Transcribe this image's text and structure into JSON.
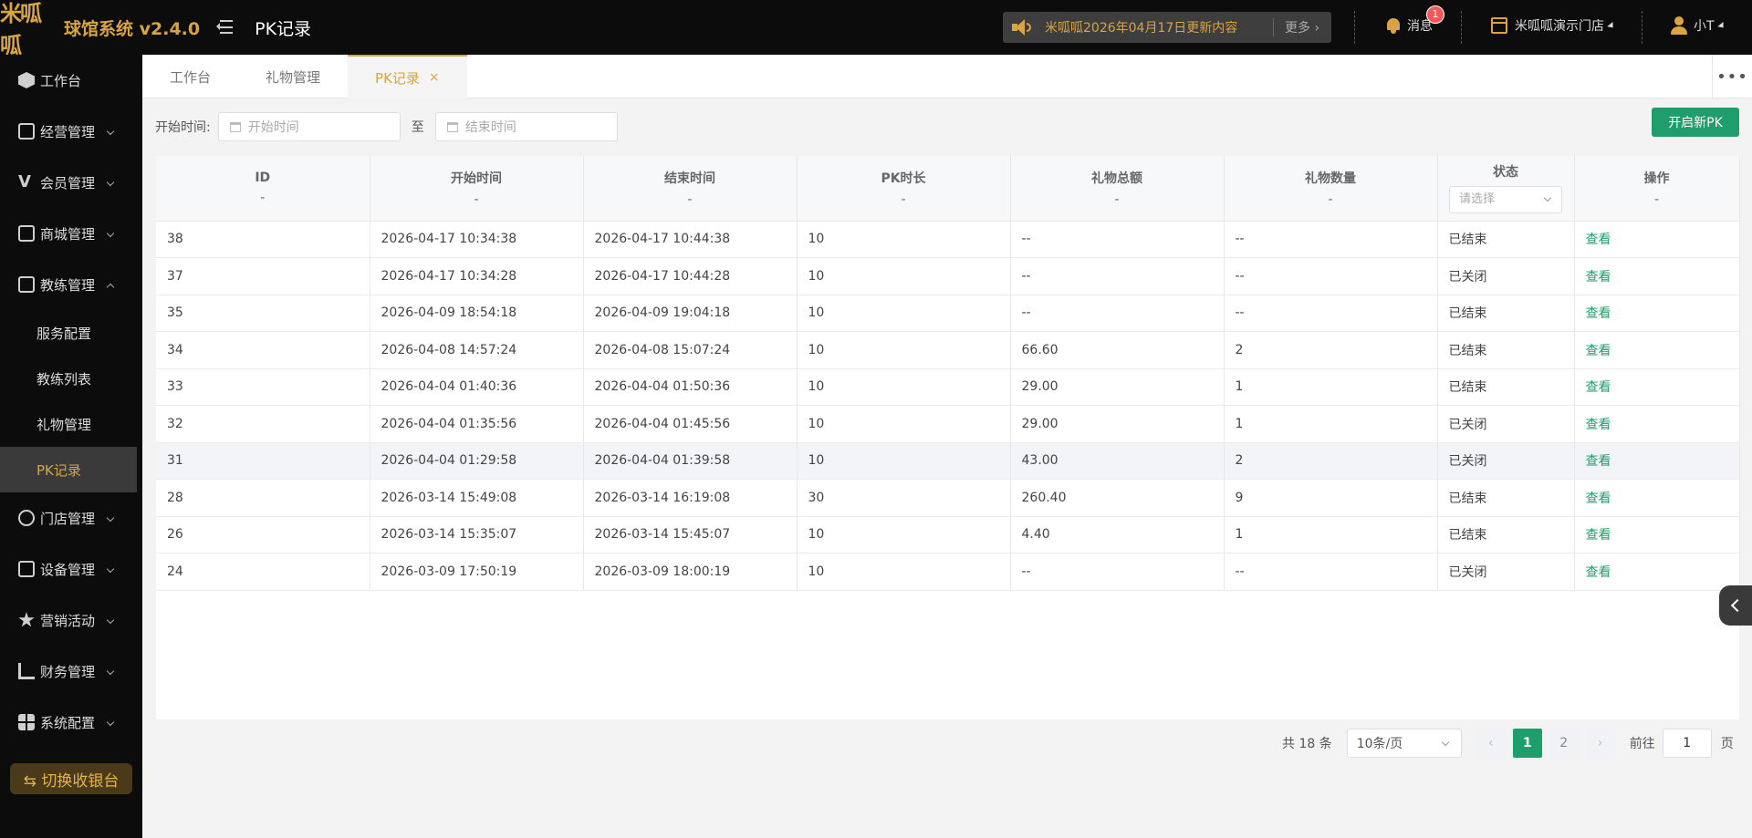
{
  "header": {
    "logo_text": "米呱呱",
    "app_name": "球馆系统 v2.4.0",
    "page_title": "PK记录",
    "notice_text": "米呱呱2026年04月17日更新内容",
    "notice_more": "更多",
    "messages_label": "消息",
    "messages_badge": "1",
    "store_name": "米呱呱演示门店",
    "user_name": "小T"
  },
  "sidebar": {
    "items": [
      {
        "label": "工作台",
        "icon": "cube-icon"
      },
      {
        "label": "经营管理",
        "icon": "shop-icon"
      },
      {
        "label": "会员管理",
        "icon": "vip-icon"
      },
      {
        "label": "商城管理",
        "icon": "bag-icon"
      },
      {
        "label": "教练管理",
        "icon": "coach-icon"
      }
    ],
    "coach_sub": [
      "服务配置",
      "教练列表",
      "礼物管理",
      "PK记录"
    ],
    "items_after": [
      {
        "label": "门店管理",
        "icon": "coins-icon"
      },
      {
        "label": "设备管理",
        "icon": "device-icon"
      },
      {
        "label": "营销活动",
        "icon": "star-icon"
      },
      {
        "label": "财务管理",
        "icon": "finance-icon"
      },
      {
        "label": "系统配置",
        "icon": "grid-icon"
      }
    ],
    "switch_button": "⇆ 切换收银台"
  },
  "tabs": [
    {
      "label": "工作台"
    },
    {
      "label": "礼物管理"
    },
    {
      "label": "PK记录",
      "close": "×"
    }
  ],
  "filters": {
    "start_label": "开始时间:",
    "start_placeholder": "开始时间",
    "to_label": "至",
    "end_placeholder": "结束时间",
    "new_pk_button": "开启新PK"
  },
  "table": {
    "columns": [
      {
        "title": "ID",
        "sub": "-"
      },
      {
        "title": "开始时间",
        "sub": "-"
      },
      {
        "title": "结束时间",
        "sub": "-"
      },
      {
        "title": "PK时长",
        "sub": "-"
      },
      {
        "title": "礼物总额",
        "sub": "-"
      },
      {
        "title": "礼物数量",
        "sub": "-"
      },
      {
        "title": "状态",
        "select_placeholder": "请选择"
      },
      {
        "title": "操作",
        "sub": "-"
      }
    ],
    "rows": [
      {
        "id": "38",
        "start": "2026-04-17 10:34:38",
        "end": "2026-04-17 10:44:38",
        "duration": "10",
        "total": "--",
        "count": "--",
        "status": "已结束",
        "action": "查看"
      },
      {
        "id": "37",
        "start": "2026-04-17 10:34:28",
        "end": "2026-04-17 10:44:28",
        "duration": "10",
        "total": "--",
        "count": "--",
        "status": "已关闭",
        "action": "查看"
      },
      {
        "id": "35",
        "start": "2026-04-09 18:54:18",
        "end": "2026-04-09 19:04:18",
        "duration": "10",
        "total": "--",
        "count": "--",
        "status": "已结束",
        "action": "查看"
      },
      {
        "id": "34",
        "start": "2026-04-08 14:57:24",
        "end": "2026-04-08 15:07:24",
        "duration": "10",
        "total": "66.60",
        "count": "2",
        "status": "已结束",
        "action": "查看"
      },
      {
        "id": "33",
        "start": "2026-04-04 01:40:36",
        "end": "2026-04-04 01:50:36",
        "duration": "10",
        "total": "29.00",
        "count": "1",
        "status": "已结束",
        "action": "查看"
      },
      {
        "id": "32",
        "start": "2026-04-04 01:35:56",
        "end": "2026-04-04 01:45:56",
        "duration": "10",
        "total": "29.00",
        "count": "1",
        "status": "已关闭",
        "action": "查看"
      },
      {
        "id": "31",
        "start": "2026-04-04 01:29:58",
        "end": "2026-04-04 01:39:58",
        "duration": "10",
        "total": "43.00",
        "count": "2",
        "status": "已关闭",
        "action": "查看"
      },
      {
        "id": "28",
        "start": "2026-03-14 15:49:08",
        "end": "2026-03-14 16:19:08",
        "duration": "30",
        "total": "260.40",
        "count": "9",
        "status": "已结束",
        "action": "查看"
      },
      {
        "id": "26",
        "start": "2026-03-14 15:35:07",
        "end": "2026-03-14 15:45:07",
        "duration": "10",
        "total": "4.40",
        "count": "1",
        "status": "已结束",
        "action": "查看"
      },
      {
        "id": "24",
        "start": "2026-03-09 17:50:19",
        "end": "2026-03-09 18:00:19",
        "duration": "10",
        "total": "--",
        "count": "--",
        "status": "已关闭",
        "action": "查看"
      }
    ]
  },
  "pagination": {
    "total_text": "共 18 条",
    "page_size": "10条/页",
    "prev": "‹",
    "pages": [
      "1",
      "2"
    ],
    "next": "›",
    "goto_label": "前往",
    "goto_value": "1",
    "page_suffix": "页"
  },
  "colors": {
    "accent_gold": "#d9a441",
    "primary_green": "#1f9d6a",
    "badge_red": "#f45858"
  }
}
